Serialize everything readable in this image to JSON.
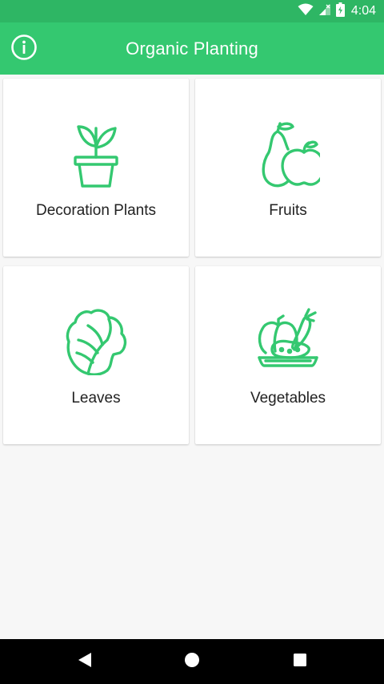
{
  "status_bar": {
    "time": "4:04",
    "icons": [
      "wifi-icon",
      "cell-signal-icon",
      "battery-icon"
    ]
  },
  "app_bar": {
    "title": "Organic Planting",
    "info_icon": "info-icon",
    "color": "#34c870"
  },
  "categories": [
    {
      "label": "Decoration Plants",
      "icon": "potted-plant-icon"
    },
    {
      "label": "Fruits",
      "icon": "fruits-icon"
    },
    {
      "label": "Leaves",
      "icon": "leaf-icon"
    },
    {
      "label": "Vegetables",
      "icon": "vegetables-icon"
    }
  ],
  "nav_bar": {
    "buttons": [
      "back-icon",
      "home-icon",
      "recents-icon"
    ]
  },
  "colors": {
    "accent": "#34c870",
    "status_bar": "#2eb664",
    "background": "#f7f7f7"
  }
}
